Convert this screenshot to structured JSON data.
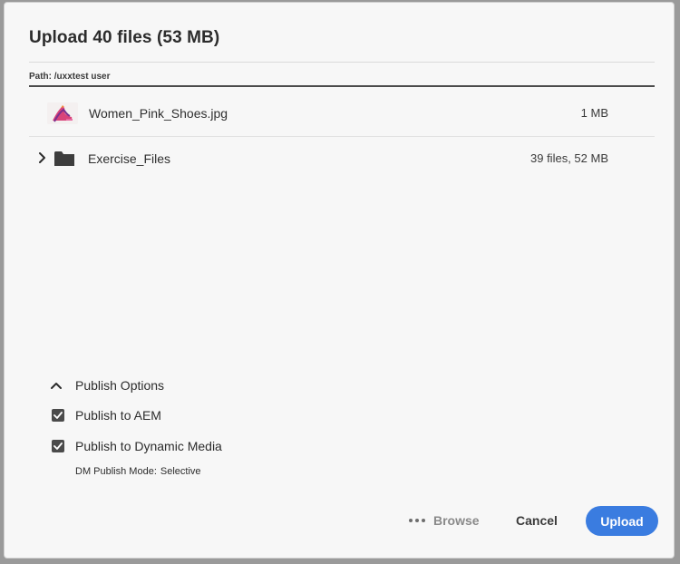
{
  "dialog": {
    "title": "Upload 40 files (53 MB)",
    "path_label": "Path: /uxxtest user"
  },
  "files": [
    {
      "name": "Women_Pink_Shoes.jpg",
      "size": "1 MB",
      "icon": "image-thumbnail-icon"
    },
    {
      "name": "Exercise_Files",
      "size": "39 files, 52 MB",
      "icon": "folder-icon"
    }
  ],
  "publish_options": {
    "header_label": "Publish Options",
    "options": [
      {
        "label": "Publish to AEM",
        "checked": true
      },
      {
        "label": "Publish to Dynamic Media",
        "checked": true
      }
    ],
    "dm_mode_label": "DM Publish Mode:",
    "dm_mode_value": "Selective"
  },
  "actions": {
    "browse_label": "Browse",
    "cancel_label": "Cancel",
    "upload_label": "Upload"
  },
  "colors": {
    "accent": "#3a7ce0",
    "checkbox": "#4b4b4b",
    "muted": "#8a8a8a"
  }
}
